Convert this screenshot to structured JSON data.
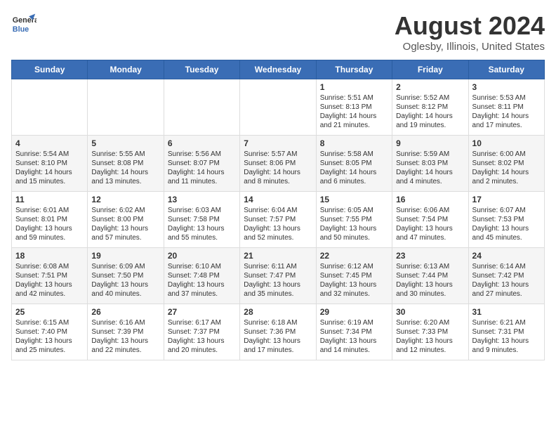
{
  "header": {
    "logo_line1": "General",
    "logo_line2": "Blue",
    "title": "August 2024",
    "subtitle": "Oglesby, Illinois, United States"
  },
  "days_of_week": [
    "Sunday",
    "Monday",
    "Tuesday",
    "Wednesday",
    "Thursday",
    "Friday",
    "Saturday"
  ],
  "weeks": [
    [
      {
        "day": "",
        "content": ""
      },
      {
        "day": "",
        "content": ""
      },
      {
        "day": "",
        "content": ""
      },
      {
        "day": "",
        "content": ""
      },
      {
        "day": "1",
        "content": "Sunrise: 5:51 AM\nSunset: 8:13 PM\nDaylight: 14 hours\nand 21 minutes."
      },
      {
        "day": "2",
        "content": "Sunrise: 5:52 AM\nSunset: 8:12 PM\nDaylight: 14 hours\nand 19 minutes."
      },
      {
        "day": "3",
        "content": "Sunrise: 5:53 AM\nSunset: 8:11 PM\nDaylight: 14 hours\nand 17 minutes."
      }
    ],
    [
      {
        "day": "4",
        "content": "Sunrise: 5:54 AM\nSunset: 8:10 PM\nDaylight: 14 hours\nand 15 minutes."
      },
      {
        "day": "5",
        "content": "Sunrise: 5:55 AM\nSunset: 8:08 PM\nDaylight: 14 hours\nand 13 minutes."
      },
      {
        "day": "6",
        "content": "Sunrise: 5:56 AM\nSunset: 8:07 PM\nDaylight: 14 hours\nand 11 minutes."
      },
      {
        "day": "7",
        "content": "Sunrise: 5:57 AM\nSunset: 8:06 PM\nDaylight: 14 hours\nand 8 minutes."
      },
      {
        "day": "8",
        "content": "Sunrise: 5:58 AM\nSunset: 8:05 PM\nDaylight: 14 hours\nand 6 minutes."
      },
      {
        "day": "9",
        "content": "Sunrise: 5:59 AM\nSunset: 8:03 PM\nDaylight: 14 hours\nand 4 minutes."
      },
      {
        "day": "10",
        "content": "Sunrise: 6:00 AM\nSunset: 8:02 PM\nDaylight: 14 hours\nand 2 minutes."
      }
    ],
    [
      {
        "day": "11",
        "content": "Sunrise: 6:01 AM\nSunset: 8:01 PM\nDaylight: 13 hours\nand 59 minutes."
      },
      {
        "day": "12",
        "content": "Sunrise: 6:02 AM\nSunset: 8:00 PM\nDaylight: 13 hours\nand 57 minutes."
      },
      {
        "day": "13",
        "content": "Sunrise: 6:03 AM\nSunset: 7:58 PM\nDaylight: 13 hours\nand 55 minutes."
      },
      {
        "day": "14",
        "content": "Sunrise: 6:04 AM\nSunset: 7:57 PM\nDaylight: 13 hours\nand 52 minutes."
      },
      {
        "day": "15",
        "content": "Sunrise: 6:05 AM\nSunset: 7:55 PM\nDaylight: 13 hours\nand 50 minutes."
      },
      {
        "day": "16",
        "content": "Sunrise: 6:06 AM\nSunset: 7:54 PM\nDaylight: 13 hours\nand 47 minutes."
      },
      {
        "day": "17",
        "content": "Sunrise: 6:07 AM\nSunset: 7:53 PM\nDaylight: 13 hours\nand 45 minutes."
      }
    ],
    [
      {
        "day": "18",
        "content": "Sunrise: 6:08 AM\nSunset: 7:51 PM\nDaylight: 13 hours\nand 42 minutes."
      },
      {
        "day": "19",
        "content": "Sunrise: 6:09 AM\nSunset: 7:50 PM\nDaylight: 13 hours\nand 40 minutes."
      },
      {
        "day": "20",
        "content": "Sunrise: 6:10 AM\nSunset: 7:48 PM\nDaylight: 13 hours\nand 37 minutes."
      },
      {
        "day": "21",
        "content": "Sunrise: 6:11 AM\nSunset: 7:47 PM\nDaylight: 13 hours\nand 35 minutes."
      },
      {
        "day": "22",
        "content": "Sunrise: 6:12 AM\nSunset: 7:45 PM\nDaylight: 13 hours\nand 32 minutes."
      },
      {
        "day": "23",
        "content": "Sunrise: 6:13 AM\nSunset: 7:44 PM\nDaylight: 13 hours\nand 30 minutes."
      },
      {
        "day": "24",
        "content": "Sunrise: 6:14 AM\nSunset: 7:42 PM\nDaylight: 13 hours\nand 27 minutes."
      }
    ],
    [
      {
        "day": "25",
        "content": "Sunrise: 6:15 AM\nSunset: 7:40 PM\nDaylight: 13 hours\nand 25 minutes."
      },
      {
        "day": "26",
        "content": "Sunrise: 6:16 AM\nSunset: 7:39 PM\nDaylight: 13 hours\nand 22 minutes."
      },
      {
        "day": "27",
        "content": "Sunrise: 6:17 AM\nSunset: 7:37 PM\nDaylight: 13 hours\nand 20 minutes."
      },
      {
        "day": "28",
        "content": "Sunrise: 6:18 AM\nSunset: 7:36 PM\nDaylight: 13 hours\nand 17 minutes."
      },
      {
        "day": "29",
        "content": "Sunrise: 6:19 AM\nSunset: 7:34 PM\nDaylight: 13 hours\nand 14 minutes."
      },
      {
        "day": "30",
        "content": "Sunrise: 6:20 AM\nSunset: 7:33 PM\nDaylight: 13 hours\nand 12 minutes."
      },
      {
        "day": "31",
        "content": "Sunrise: 6:21 AM\nSunset: 7:31 PM\nDaylight: 13 hours\nand 9 minutes."
      }
    ]
  ]
}
